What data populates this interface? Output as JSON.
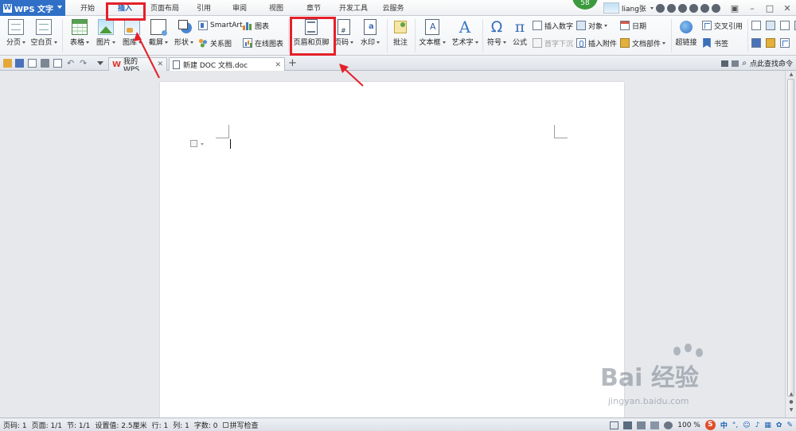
{
  "app": {
    "name": "WPS 文字",
    "logo_letter": "W"
  },
  "menu": {
    "tabs": [
      {
        "label": "开始"
      },
      {
        "label": "插入"
      },
      {
        "label": "页面布局"
      },
      {
        "label": "引用"
      },
      {
        "label": "审阅"
      },
      {
        "label": "视图"
      },
      {
        "label": "章节"
      },
      {
        "label": "开发工具"
      },
      {
        "label": "云服务"
      }
    ],
    "active_tab": "插入",
    "badge": "58",
    "user": "liang张"
  },
  "ribbon": {
    "page_break": "分页",
    "blank_page": "空白页",
    "table": "表格",
    "picture": "图片",
    "gallery": "图库",
    "screenshot": "截屏",
    "shape": "形状",
    "smartart": "SmartArt",
    "chart": "图表",
    "relation_chart": "关系图",
    "online_chart": "在线图表",
    "header_footer": "页眉和页脚",
    "page_number": "页码",
    "watermark": "水印",
    "comment": "批注",
    "text_box": "文本框",
    "word_art": "艺术字",
    "symbol": "符号",
    "formula": "公式",
    "insert_number": "插入数字",
    "object": "对象",
    "drop_cap": "首字下沉",
    "insert_attachment": "插入附件",
    "date": "日期",
    "document_parts": "文档部件",
    "hyperlink": "超链接",
    "cross_reference": "交叉引用",
    "bookmark": "书签"
  },
  "tabbar": {
    "tabs": [
      {
        "label": "我的WPS"
      },
      {
        "label": "新建 DOC 文档.doc"
      }
    ],
    "new_tab": "+",
    "find_command": "点此查找命令"
  },
  "status": {
    "page_num": "页码: 1",
    "page": "页面: 1/1",
    "section": "节: 1/1",
    "setting": "设置值: 2.5厘米",
    "row": "行: 1",
    "col": "列: 1",
    "word_count": "字数: 0",
    "spell_check": "拼写检查",
    "zoom": "100 %",
    "ime": "中"
  },
  "watermark": {
    "brand": "Bai 经验",
    "url": "jingyan.baidu.com"
  },
  "colors": {
    "accent": "#2f6fc6",
    "highlight": "#e5202a",
    "badge": "#3c9a3e"
  }
}
